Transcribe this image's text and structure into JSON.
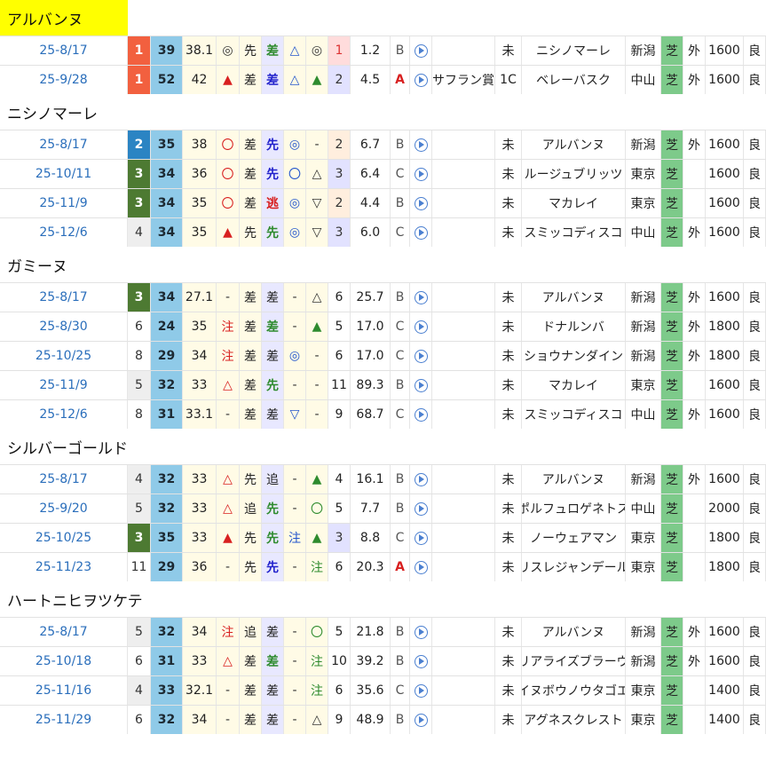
{
  "groups": [
    {
      "name": "アルバンヌ",
      "selected": true,
      "rows": [
        {
          "date": "25-8/17",
          "rank": "1",
          "rankcls": "rk1",
          "idx": "39",
          "val": "38.1",
          "m1": "◎",
          "m1c": "circ",
          "pos": "先",
          "pc": "",
          "m2": "差",
          "m2c": "greent",
          "m3": "△",
          "m3c": "bluemark",
          "m4": "◎",
          "m4c": "circ",
          "pop": "1",
          "popc": "pk1",
          "odds": "1.2",
          "cond": "B",
          "race": "",
          "cls": "未",
          "winner": "ニシノマーレ",
          "venue": "新潟",
          "outer": "外",
          "dist": "1600",
          "track": "良"
        },
        {
          "date": "25-9/28",
          "rank": "1",
          "rankcls": "rk1",
          "idx": "52",
          "val": "42",
          "m1": "▲",
          "m1c": "rtri",
          "pos": "差",
          "pc": "",
          "m2": "差",
          "m2c": "bluet",
          "m3": "△",
          "m3c": "bluemark",
          "m4": "▲",
          "m4c": "gtri",
          "pop": "2",
          "popc": "pk3",
          "odds": "4.5",
          "cond": "A",
          "race": "サフラン賞",
          "cls": "1C",
          "winner": "ベレーバスク",
          "venue": "中山",
          "outer": "外",
          "dist": "1600",
          "track": "良"
        }
      ]
    },
    {
      "name": "ニシノマーレ",
      "selected": false,
      "rows": [
        {
          "date": "25-8/17",
          "rank": "2",
          "rankcls": "rk2",
          "idx": "35",
          "val": "38",
          "m1": "〇",
          "m1c": "rtri",
          "pos": "差",
          "pc": "",
          "m2": "先",
          "m2c": "bluet",
          "m3": "◎",
          "m3c": "bluemark",
          "m4": "-",
          "m4c": "circ",
          "pop": "2",
          "popc": "pk2",
          "odds": "6.7",
          "cond": "B",
          "race": "",
          "cls": "未",
          "winner": "アルバンヌ",
          "venue": "新潟",
          "outer": "外",
          "dist": "1600",
          "track": "良"
        },
        {
          "date": "25-10/11",
          "rank": "3",
          "rankcls": "rk3",
          "idx": "34",
          "val": "36",
          "m1": "〇",
          "m1c": "rtri",
          "pos": "差",
          "pc": "",
          "m2": "先",
          "m2c": "bluet",
          "m3": "〇",
          "m3c": "bluemark",
          "m4": "△",
          "m4c": "circ",
          "pop": "3",
          "popc": "pk3",
          "odds": "6.4",
          "cond": "C",
          "race": "",
          "cls": "未",
          "winner": "ルージュブリッツ",
          "venue": "東京",
          "outer": "",
          "dist": "1600",
          "track": "良"
        },
        {
          "date": "25-11/9",
          "rank": "3",
          "rankcls": "rk3",
          "idx": "34",
          "val": "35",
          "m1": "〇",
          "m1c": "rtri",
          "pos": "差",
          "pc": "",
          "m2": "逃",
          "m2c": "red",
          "m3": "◎",
          "m3c": "bluemark",
          "m4": "▽",
          "m4c": "circ",
          "pop": "2",
          "popc": "pk2",
          "odds": "4.4",
          "cond": "B",
          "race": "",
          "cls": "未",
          "winner": "マカレイ",
          "venue": "東京",
          "outer": "",
          "dist": "1600",
          "track": "良"
        },
        {
          "date": "25-12/6",
          "rank": "4",
          "rankcls": "rkg",
          "idx": "34",
          "val": "35",
          "m1": "▲",
          "m1c": "rtri",
          "pos": "先",
          "pc": "",
          "m2": "先",
          "m2c": "greent",
          "m3": "◎",
          "m3c": "bluemark",
          "m4": "▽",
          "m4c": "circ",
          "pop": "3",
          "popc": "pk3",
          "odds": "6.0",
          "cond": "C",
          "race": "",
          "cls": "未",
          "winner": "スミッコディスコ",
          "venue": "中山",
          "outer": "外",
          "dist": "1600",
          "track": "良"
        }
      ]
    },
    {
      "name": "ガミーヌ",
      "selected": false,
      "rows": [
        {
          "date": "25-8/17",
          "rank": "3",
          "rankcls": "rk3",
          "idx": "34",
          "val": "27.1",
          "m1": "-",
          "m1c": "circ",
          "pos": "差",
          "pc": "",
          "m2": "差",
          "m2c": "",
          "m3": "-",
          "m3c": "circ",
          "m4": "△",
          "m4c": "circ",
          "pop": "6",
          "popc": "",
          "odds": "25.7",
          "cond": "B",
          "race": "",
          "cls": "未",
          "winner": "アルバンヌ",
          "venue": "新潟",
          "outer": "外",
          "dist": "1600",
          "track": "良"
        },
        {
          "date": "25-8/30",
          "rank": "6",
          "rankcls": "rkn",
          "idx": "24",
          "val": "35",
          "m1": "注",
          "m1c": "rtri",
          "pos": "差",
          "pc": "",
          "m2": "差",
          "m2c": "greent",
          "m3": "-",
          "m3c": "circ",
          "m4": "▲",
          "m4c": "gtri",
          "pop": "5",
          "popc": "",
          "odds": "17.0",
          "cond": "C",
          "race": "",
          "cls": "未",
          "winner": "ドナルンバ",
          "venue": "新潟",
          "outer": "外",
          "dist": "1800",
          "track": "良"
        },
        {
          "date": "25-10/25",
          "rank": "8",
          "rankcls": "rkn",
          "idx": "29",
          "val": "34",
          "m1": "注",
          "m1c": "rtri",
          "pos": "差",
          "pc": "",
          "m2": "差",
          "m2c": "",
          "m3": "◎",
          "m3c": "bluemark",
          "m4": "-",
          "m4c": "circ",
          "pop": "6",
          "popc": "",
          "odds": "17.0",
          "cond": "C",
          "race": "",
          "cls": "未",
          "winner": "ショウナンダイン",
          "venue": "新潟",
          "outer": "外",
          "dist": "1800",
          "track": "良"
        },
        {
          "date": "25-11/9",
          "rank": "5",
          "rankcls": "rkg",
          "idx": "32",
          "val": "33",
          "m1": "△",
          "m1c": "rtri",
          "pos": "差",
          "pc": "",
          "m2": "先",
          "m2c": "greent",
          "m3": "-",
          "m3c": "circ",
          "m4": "-",
          "m4c": "circ",
          "pop": "11",
          "popc": "",
          "odds": "89.3",
          "cond": "B",
          "race": "",
          "cls": "未",
          "winner": "マカレイ",
          "venue": "東京",
          "outer": "",
          "dist": "1600",
          "track": "良"
        },
        {
          "date": "25-12/6",
          "rank": "8",
          "rankcls": "rkn",
          "idx": "31",
          "val": "33.1",
          "m1": "-",
          "m1c": "circ",
          "pos": "差",
          "pc": "",
          "m2": "差",
          "m2c": "",
          "m3": "▽",
          "m3c": "bluemark",
          "m4": "-",
          "m4c": "circ",
          "pop": "9",
          "popc": "",
          "odds": "68.7",
          "cond": "C",
          "race": "",
          "cls": "未",
          "winner": "スミッコディスコ",
          "venue": "中山",
          "outer": "外",
          "dist": "1600",
          "track": "良"
        }
      ]
    },
    {
      "name": "シルバーゴールド",
      "selected": false,
      "rows": [
        {
          "date": "25-8/17",
          "rank": "4",
          "rankcls": "rkg",
          "idx": "32",
          "val": "33",
          "m1": "△",
          "m1c": "rtri",
          "pos": "先",
          "pc": "",
          "m2": "追",
          "m2c": "",
          "m3": "-",
          "m3c": "circ",
          "m4": "▲",
          "m4c": "gtri",
          "pop": "4",
          "popc": "",
          "odds": "16.1",
          "cond": "B",
          "race": "",
          "cls": "未",
          "winner": "アルバンヌ",
          "venue": "新潟",
          "outer": "外",
          "dist": "1600",
          "track": "良"
        },
        {
          "date": "25-9/20",
          "rank": "5",
          "rankcls": "rkg",
          "idx": "32",
          "val": "33",
          "m1": "△",
          "m1c": "rtri",
          "pos": "追",
          "pc": "",
          "m2": "先",
          "m2c": "greent",
          "m3": "-",
          "m3c": "circ",
          "m4": "〇",
          "m4c": "gmark",
          "pop": "5",
          "popc": "",
          "odds": "7.7",
          "cond": "B",
          "race": "",
          "cls": "未",
          "winner": "ポルフュロゲネトス",
          "venue": "中山",
          "outer": "",
          "dist": "2000",
          "track": "良"
        },
        {
          "date": "25-10/25",
          "rank": "3",
          "rankcls": "rk3",
          "idx": "35",
          "val": "33",
          "m1": "▲",
          "m1c": "rtri",
          "pos": "先",
          "pc": "",
          "m2": "先",
          "m2c": "greent",
          "m3": "注",
          "m3c": "bluemark",
          "m4": "▲",
          "m4c": "gtri",
          "pop": "3",
          "popc": "pk3",
          "odds": "8.8",
          "cond": "C",
          "race": "",
          "cls": "未",
          "winner": "ノーウェアマン",
          "venue": "東京",
          "outer": "",
          "dist": "1800",
          "track": "良"
        },
        {
          "date": "25-11/23",
          "rank": "11",
          "rankcls": "rkn",
          "idx": "29",
          "val": "36",
          "m1": "-",
          "m1c": "circ",
          "pos": "先",
          "pc": "",
          "m2": "先",
          "m2c": "bluet",
          "m3": "-",
          "m3c": "circ",
          "m4": "注",
          "m4c": "gmark",
          "pop": "6",
          "popc": "",
          "odds": "20.3",
          "cond": "A",
          "race": "",
          "cls": "未",
          "winner": "リスレジャンデール",
          "venue": "東京",
          "outer": "",
          "dist": "1800",
          "track": "良"
        }
      ]
    },
    {
      "name": "ハートニヒヲツケテ",
      "selected": false,
      "rows": [
        {
          "date": "25-8/17",
          "rank": "5",
          "rankcls": "rkg",
          "idx": "32",
          "val": "34",
          "m1": "注",
          "m1c": "rtri",
          "pos": "追",
          "pc": "",
          "m2": "差",
          "m2c": "",
          "m3": "-",
          "m3c": "circ",
          "m4": "〇",
          "m4c": "gmark",
          "pop": "5",
          "popc": "",
          "odds": "21.8",
          "cond": "B",
          "race": "",
          "cls": "未",
          "winner": "アルバンヌ",
          "venue": "新潟",
          "outer": "外",
          "dist": "1600",
          "track": "良"
        },
        {
          "date": "25-10/18",
          "rank": "6",
          "rankcls": "rkn",
          "idx": "31",
          "val": "33",
          "m1": "△",
          "m1c": "rtri",
          "pos": "差",
          "pc": "",
          "m2": "差",
          "m2c": "greent",
          "m3": "-",
          "m3c": "circ",
          "m4": "注",
          "m4c": "gmark",
          "pop": "10",
          "popc": "",
          "odds": "39.2",
          "cond": "B",
          "race": "",
          "cls": "未",
          "winner": "リアライズブラーヴ",
          "venue": "新潟",
          "outer": "外",
          "dist": "1600",
          "track": "良"
        },
        {
          "date": "25-11/16",
          "rank": "4",
          "rankcls": "rkg",
          "idx": "33",
          "val": "32.1",
          "m1": "-",
          "m1c": "circ",
          "pos": "差",
          "pc": "",
          "m2": "差",
          "m2c": "",
          "m3": "-",
          "m3c": "circ",
          "m4": "注",
          "m4c": "gmark",
          "pop": "6",
          "popc": "",
          "odds": "35.6",
          "cond": "C",
          "race": "",
          "cls": "未",
          "winner": "イヌボウノウタゴエ",
          "venue": "東京",
          "outer": "",
          "dist": "1400",
          "track": "良"
        },
        {
          "date": "25-11/29",
          "rank": "6",
          "rankcls": "rkn",
          "idx": "32",
          "val": "34",
          "m1": "-",
          "m1c": "circ",
          "pos": "差",
          "pc": "",
          "m2": "差",
          "m2c": "",
          "m3": "-",
          "m3c": "circ",
          "m4": "△",
          "m4c": "circ",
          "pop": "9",
          "popc": "",
          "odds": "48.9",
          "cond": "B",
          "race": "",
          "cls": "未",
          "winner": "アグネスクレスト",
          "venue": "東京",
          "outer": "",
          "dist": "1400",
          "track": "良"
        }
      ]
    }
  ],
  "surface_label": "芝",
  "play_icon": "play-circle-icon",
  "colors": {
    "highlight": "#ffff00",
    "turf": "#7dca8a",
    "index": "#8fcae8",
    "date": "#2a6ebb"
  }
}
